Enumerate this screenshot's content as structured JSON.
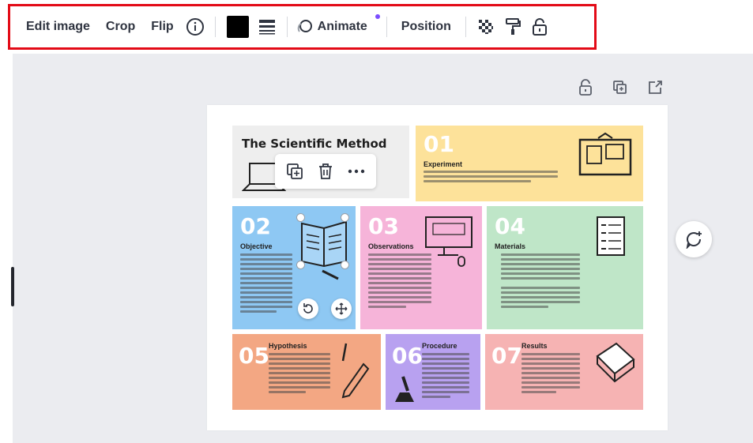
{
  "toolbar": {
    "edit_image": "Edit image",
    "crop": "Crop",
    "flip": "Flip",
    "info_icon": "info-circle-icon",
    "color_swatch": "#000000",
    "border_style_icon": "border-lines-icon",
    "animate": "Animate",
    "position": "Position",
    "transparency_icon": "checkerboard-icon",
    "copy_style_icon": "paint-roller-icon",
    "lock_icon": "lock-icon"
  },
  "page_actions": [
    "lock-icon",
    "duplicate-page-icon",
    "share-page-icon"
  ],
  "infographic": {
    "title": "The Scientific Method",
    "cells": [
      {
        "number": "01",
        "label": "Experiment",
        "color": "#fde29a"
      },
      {
        "number": "02",
        "label": "Objective",
        "color": "#8ec8f3"
      },
      {
        "number": "03",
        "label": "Observations",
        "color": "#f6b4d9"
      },
      {
        "number": "04",
        "label": "Materials",
        "color": "#bfe6c8"
      },
      {
        "number": "05",
        "label": "Hypothesis",
        "color": "#f3a783"
      },
      {
        "number": "06",
        "label": "Procedure",
        "color": "#b8a1f0"
      },
      {
        "number": "07",
        "label": "Results",
        "color": "#f6b3b3"
      }
    ]
  }
}
